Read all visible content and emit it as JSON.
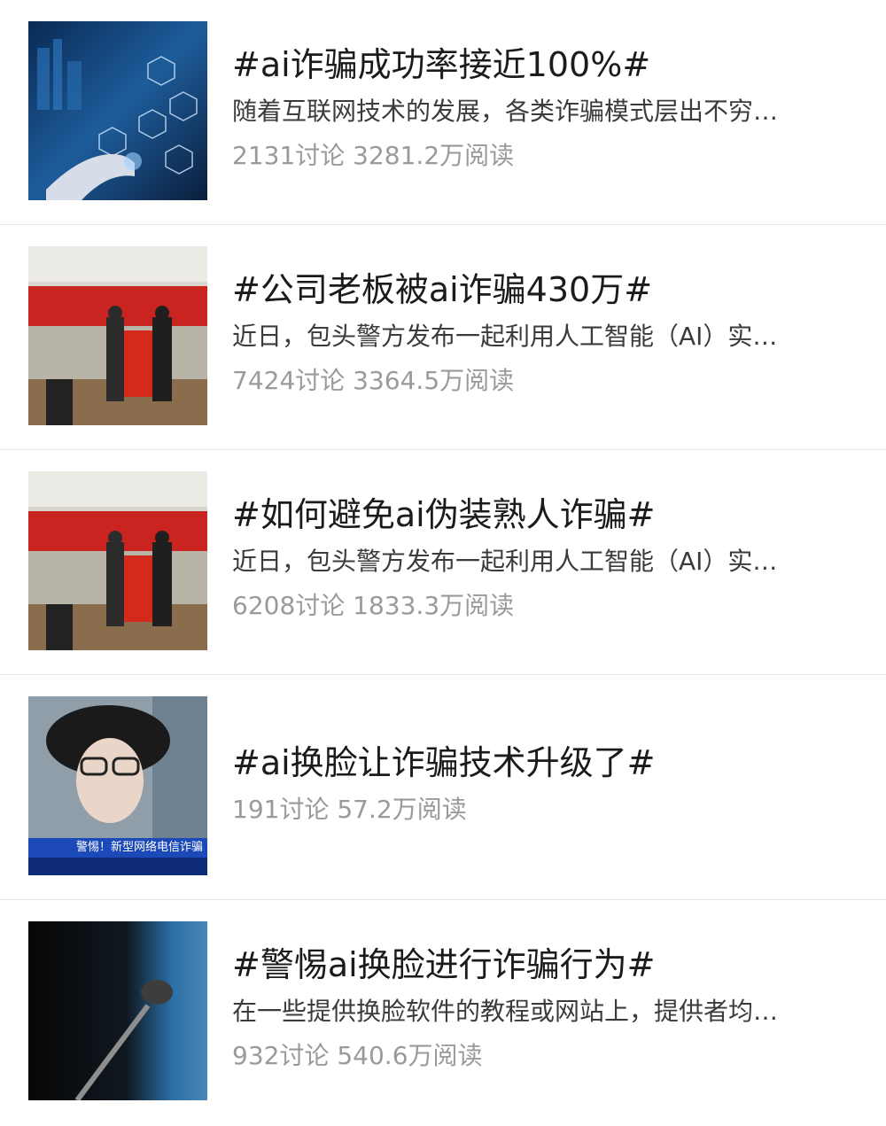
{
  "topics": [
    {
      "title": "#ai诈骗成功率接近100%#",
      "summary": "随着互联网技术的发展，各类诈骗模式层出不穷…",
      "stats": "2131讨论 3281.2万阅读",
      "thumbnail": "tech-hand-icon"
    },
    {
      "title": "#公司老板被ai诈骗430万#",
      "summary": "近日，包头警方发布一起利用人工智能（AI）实…",
      "stats": "7424讨论 3364.5万阅读",
      "thumbnail": "banner-ceremony-icon"
    },
    {
      "title": "#如何避免ai伪装熟人诈骗#",
      "summary": "近日，包头警方发布一起利用人工智能（AI）实…",
      "stats": "6208讨论 1833.3万阅读",
      "thumbnail": "banner-ceremony-icon"
    },
    {
      "title": "#ai换脸让诈骗技术升级了#",
      "summary": "",
      "stats": "191讨论 57.2万阅读",
      "thumbnail": "news-portrait-icon",
      "thumbnail_caption": "警惕！新型网络电信诈骗"
    },
    {
      "title": "#警惕ai换脸进行诈骗行为#",
      "summary": "在一些提供换脸软件的教程或网站上，提供者均…",
      "stats": "932讨论 540.6万阅读",
      "thumbnail": "microphone-icon"
    }
  ]
}
